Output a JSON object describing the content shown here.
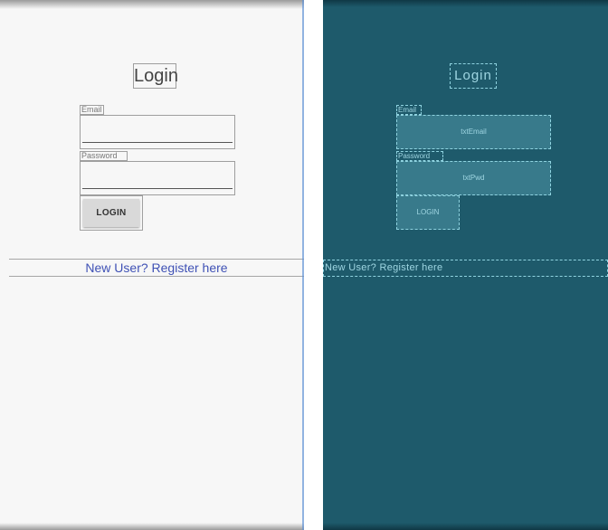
{
  "design": {
    "title": "Login",
    "email_label": "Email",
    "password_label": "Password",
    "login_button": "LOGIN",
    "register_link": "New User? Register here"
  },
  "blueprint": {
    "title": "Login",
    "email_label": "Email",
    "email_id": "txtEmail",
    "password_label": "Password",
    "password_id": "txtPwd",
    "login_button": "LOGIN",
    "register_link": "New User? Register here"
  },
  "colors": {
    "design_background": "#f7f7f7",
    "blueprint_background": "#1e5a6b",
    "link": "#3f51b5",
    "blueprint_outline": "#8fd3e0"
  }
}
